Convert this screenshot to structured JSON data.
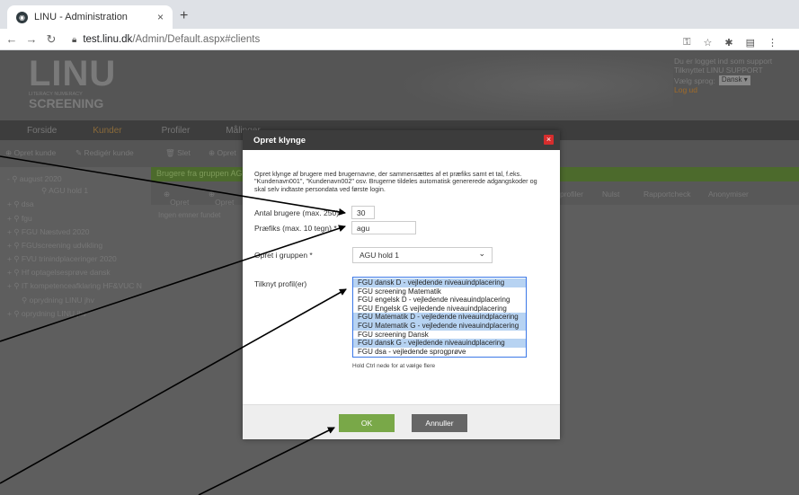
{
  "browser": {
    "tab_title": "LINU - Administration",
    "tab_close": "×",
    "new_tab": "+",
    "url_domain": "test.linu.dk",
    "url_path": "/Admin/Default.aspx#clients"
  },
  "header": {
    "logo_big": "LINU",
    "logo_small_1": "LITERACY NUMERACY",
    "logo_small_2": "SCREENING",
    "user_line1": "Du er logget ind som support",
    "user_line2": "Tilknyttet LINU SUPPORT",
    "lang_label": "Vælg sprog:",
    "lang_value": "Dansk",
    "logout": "Log ud"
  },
  "nav": [
    "Forside",
    "Kunder",
    "Profiler",
    "Målinger"
  ],
  "toolbar": [
    "Opret kunde",
    "Redigér kunde",
    "Slet",
    "Opret"
  ],
  "sidebar": [
    {
      "label": "august 2020",
      "indent": 0,
      "prefix": "- "
    },
    {
      "label": "AGU hold 1",
      "indent": 1,
      "prefix": ""
    },
    {
      "label": "dsa",
      "indent": 0,
      "prefix": "+ "
    },
    {
      "label": "fgu",
      "indent": 0,
      "prefix": "+ "
    },
    {
      "label": "FGU Næstved 2020",
      "indent": 0,
      "prefix": "+ "
    },
    {
      "label": "FGUscreening udvikling",
      "indent": 0,
      "prefix": "+ "
    },
    {
      "label": "FVU trinindplaceringer 2020",
      "indent": 0,
      "prefix": "+ "
    },
    {
      "label": "Hf optagelsesprøve dansk",
      "indent": 0,
      "prefix": "+ "
    },
    {
      "label": "IT kompetenceafklaring HF&VUC N",
      "indent": 0,
      "prefix": "+ "
    },
    {
      "label": "oprydning LINU jhv",
      "indent": 1,
      "prefix": ""
    },
    {
      "label": "oprydning LINU jhv",
      "indent": 0,
      "prefix": "+ "
    }
  ],
  "content": {
    "green_bar": "Brugere fra gruppen AG",
    "subbar": [
      "Opret",
      "Opret",
      "profiler",
      "Nulst",
      "Rapportcheck",
      "Anonymiser"
    ],
    "no_items": "Ingen emner fundet"
  },
  "modal": {
    "title": "Opret klynge",
    "close": "×",
    "description": "Opret klynge af brugere med brugernavne, der sammensættes af et præfiks samt et tal, f.eks. \"Kundenavn001\", \"Kundenavn002\" osv. Brugerne tildeles automatisk genererede adgangskoder og skal selv indtaste persondata ved første login.",
    "count_label": "Antal brugere (max. 250) *",
    "count_value": "30",
    "prefix_label": "Præfiks (max. 10 tegn) *",
    "prefix_value": "agu",
    "group_label": "Opret i gruppen *",
    "group_value": "AGU hold 1",
    "profile_label": "Tilknyt profil(er)",
    "profiles": [
      {
        "label": "FGU dansk D - vejledende niveauindplacering",
        "selected": true
      },
      {
        "label": "FGU screening Matematik",
        "selected": false
      },
      {
        "label": "FGU engelsk D - vejledende niveauindplacering",
        "selected": false
      },
      {
        "label": "FGU Engelsk G vejledende niveauindplacering",
        "selected": false
      },
      {
        "label": "FGU Matematik D - vejledende niveauindplacering",
        "selected": true
      },
      {
        "label": "FGU Matematik G - vejledende niveauindplacering",
        "selected": true
      },
      {
        "label": "FGU screening Dansk",
        "selected": false
      },
      {
        "label": "FGU dansk G - vejledende niveauindplacering",
        "selected": true
      },
      {
        "label": "FGU dsa - vejledende sprogprøve",
        "selected": false
      }
    ],
    "hint": "Hold Ctrl nede for at vælge flere",
    "ok": "OK",
    "cancel": "Annuller"
  }
}
